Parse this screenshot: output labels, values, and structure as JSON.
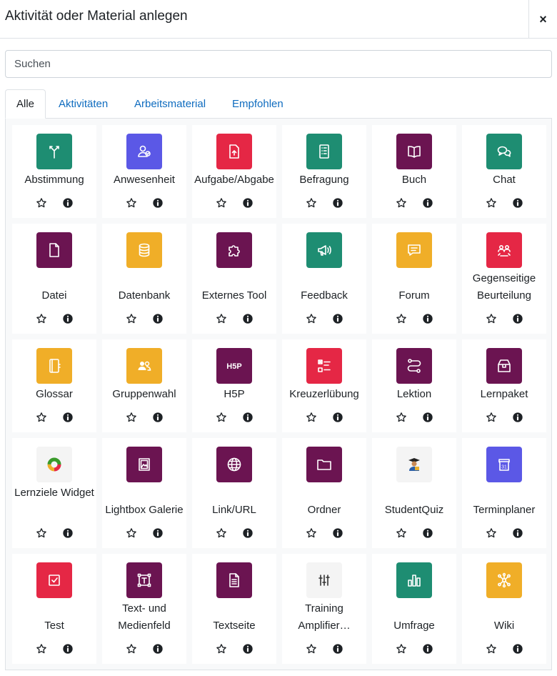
{
  "dialog": {
    "title": "Aktivität oder Material anlegen",
    "close_label": "×"
  },
  "search": {
    "placeholder": "Suchen"
  },
  "tabs": [
    "Alle",
    "Aktivitäten",
    "Arbeitsmaterial",
    "Empfohlen"
  ],
  "colors": {
    "green": "#1e8d72",
    "blue": "#5b58e6",
    "red": "#e52745",
    "purple": "#6b1451",
    "yellow": "#f0ae28",
    "light": "#f4f4f4",
    "link": "#0f6cbf"
  },
  "rows": [
    [
      {
        "name": "Abstimmung",
        "icon": "choice-icon",
        "color": "green"
      },
      {
        "name": "Anwesenheit",
        "icon": "attendance-icon",
        "color": "blue"
      },
      {
        "name": "Aufgabe/Abgabe",
        "icon": "assignment-icon",
        "color": "red"
      },
      {
        "name": "Befragung",
        "icon": "survey-icon",
        "color": "green"
      },
      {
        "name": "Buch",
        "icon": "book-icon",
        "color": "purple"
      },
      {
        "name": "Chat",
        "icon": "chat-icon",
        "color": "green"
      }
    ],
    [
      {
        "name": "Datei",
        "icon": "file-icon",
        "color": "purple"
      },
      {
        "name": "Datenbank",
        "icon": "database-icon",
        "color": "yellow"
      },
      {
        "name": "Externes Tool",
        "icon": "puzzle-icon",
        "color": "purple"
      },
      {
        "name": "Feedback",
        "icon": "megaphone-icon",
        "color": "green"
      },
      {
        "name": "Forum",
        "icon": "forum-icon",
        "color": "yellow"
      },
      {
        "name": "Gegenseitige Beurteilung",
        "icon": "workshop-icon",
        "color": "red"
      }
    ],
    [
      {
        "name": "Glossar",
        "icon": "glossary-icon",
        "color": "yellow"
      },
      {
        "name": "Gruppenwahl",
        "icon": "group-icon",
        "color": "yellow"
      },
      {
        "name": "H5P",
        "icon": "h5p-icon",
        "color": "purple"
      },
      {
        "name": "Kreuzerlübung",
        "icon": "checklist-icon",
        "color": "red"
      },
      {
        "name": "Lektion",
        "icon": "lesson-icon",
        "color": "purple"
      },
      {
        "name": "Lernpaket",
        "icon": "package-icon",
        "color": "purple"
      }
    ],
    [
      {
        "name": "Lernziele Widget",
        "icon": "donut-icon",
        "color": "light"
      },
      {
        "name": "Lightbox Galerie",
        "icon": "gallery-icon",
        "color": "purple"
      },
      {
        "name": "Link/URL",
        "icon": "globe-icon",
        "color": "purple"
      },
      {
        "name": "Ordner",
        "icon": "folder-icon",
        "color": "purple"
      },
      {
        "name": "StudentQuiz",
        "icon": "studentquiz-icon",
        "color": "light"
      },
      {
        "name": "Terminplaner",
        "icon": "calendar-icon",
        "color": "blue"
      }
    ],
    [
      {
        "name": "Test",
        "icon": "quiz-icon",
        "color": "red"
      },
      {
        "name": "Text- und Medienfeld",
        "icon": "textframe-icon",
        "color": "purple"
      },
      {
        "name": "Textseite",
        "icon": "page-icon",
        "color": "purple"
      },
      {
        "name": "Training Amplifier…",
        "icon": "sliders-icon",
        "color": "light"
      },
      {
        "name": "Umfrage",
        "icon": "barchart-icon",
        "color": "green"
      },
      {
        "name": "Wiki",
        "icon": "wiki-icon",
        "color": "yellow"
      }
    ]
  ]
}
